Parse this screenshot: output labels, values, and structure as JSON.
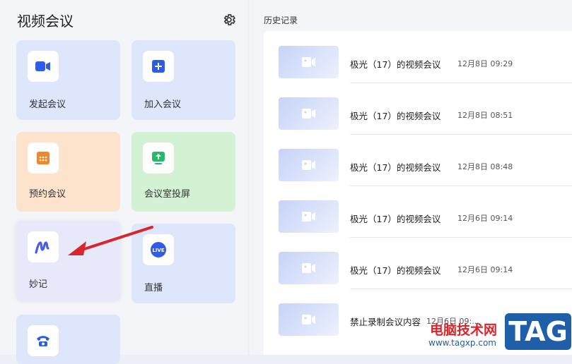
{
  "app": {
    "title": "视频会议"
  },
  "tiles": [
    {
      "label": "发起会议",
      "icon": "video-camera-icon"
    },
    {
      "label": "加入会议",
      "icon": "plus-icon"
    },
    {
      "label": "预约会议",
      "icon": "calendar-icon"
    },
    {
      "label": "会议室投屏",
      "icon": "screen-share-icon"
    },
    {
      "label": "妙记",
      "icon": "minutes-icon"
    },
    {
      "label": "直播",
      "icon": "live-icon",
      "badge": "LIVE"
    },
    {
      "label": "",
      "icon": "phone-icon"
    }
  ],
  "history": {
    "title": "历史记录",
    "items": [
      {
        "name": "极光（17）的视频会议",
        "time": "12月8日 09:29"
      },
      {
        "name": "极光（17）的视频会议",
        "time": "12月8日 08:51"
      },
      {
        "name": "极光（17）的视频会议",
        "time": "12月8日 08:48"
      },
      {
        "name": "极光（17）的视频会议",
        "time": "12月6日 09:14"
      },
      {
        "name": "极光（17）的视频会议",
        "time": "12月6日 09:14"
      },
      {
        "name": "禁止录制会议内容",
        "time": "12月6日 09:..."
      }
    ]
  },
  "watermark": {
    "brand": "电脑技术网",
    "tag": "TAG",
    "url": "www.tagxp.com"
  },
  "colors": {
    "accent": "#2f5bea",
    "arrow": "#d9262c"
  }
}
